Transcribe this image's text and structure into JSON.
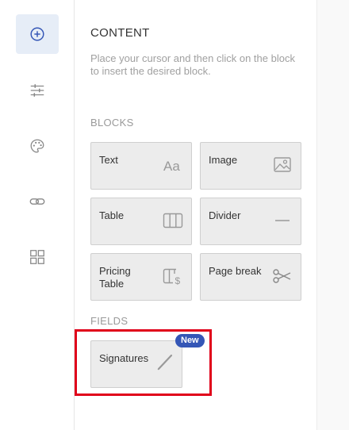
{
  "rail": {
    "items": [
      {
        "name": "content",
        "icon": "plus-circle-icon",
        "active": true
      },
      {
        "name": "settings",
        "icon": "sliders-icon",
        "active": false
      },
      {
        "name": "design",
        "icon": "palette-icon",
        "active": false
      },
      {
        "name": "links",
        "icon": "link-icon",
        "active": false
      },
      {
        "name": "apps",
        "icon": "grid-icon",
        "active": false
      }
    ]
  },
  "panel": {
    "title": "CONTENT",
    "description": "Place your cursor and then click on the block to insert the desired block.",
    "blocks_label": "BLOCKS",
    "fields_label": "FIELDS",
    "blocks": [
      {
        "label": "Text",
        "icon": "text-aa-icon"
      },
      {
        "label": "Image",
        "icon": "image-icon"
      },
      {
        "label": "Table",
        "icon": "table-columns-icon"
      },
      {
        "label": "Divider",
        "icon": "divider-line-icon"
      },
      {
        "label": "Pricing Table",
        "icon": "pricing-table-icon"
      },
      {
        "label": "Page break",
        "icon": "scissors-icon"
      }
    ],
    "fields": [
      {
        "label": "Signatures",
        "icon": "pen-icon",
        "badge": "New"
      }
    ]
  },
  "colors": {
    "accent": "#3456b6",
    "active_rail": "#e6edf7",
    "highlight": "#e0001a"
  }
}
